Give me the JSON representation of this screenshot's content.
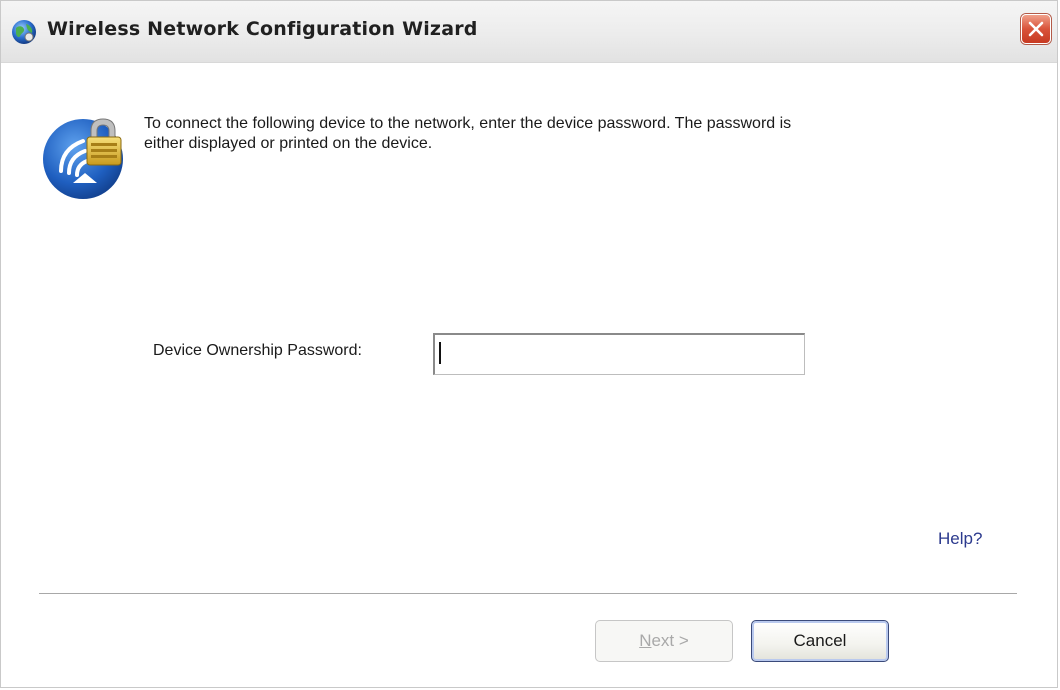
{
  "window": {
    "title": "Wireless Network Configuration Wizard",
    "title_icon": "globe-network-icon",
    "close_icon": "close-icon"
  },
  "content": {
    "wizard_icon": "wireless-lock-icon",
    "intro_line1": "To connect the following device to the network, enter the device password. The password is",
    "intro_line2": "either displayed or printed on the device.",
    "password_label": "Device Ownership Password:",
    "password_value": "",
    "help_link": "Help?"
  },
  "buttons": {
    "next_prefix": "N",
    "next_rest": "ext >",
    "cancel_label": "Cancel"
  },
  "colors": {
    "close_button": "#d9533a",
    "help_link": "#2c3a8e",
    "disabled_text": "#a9a9a9"
  }
}
